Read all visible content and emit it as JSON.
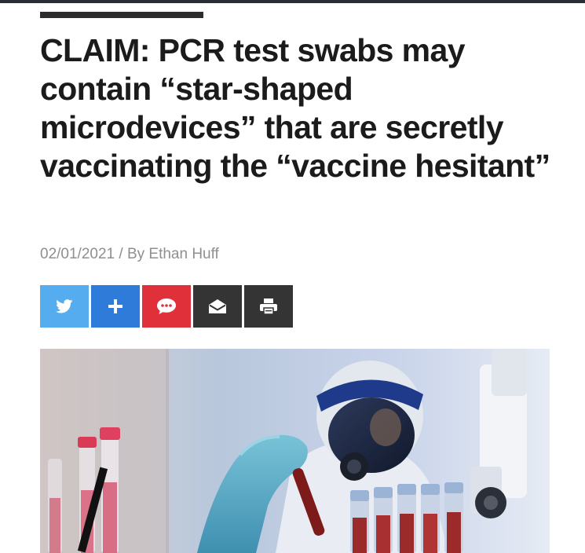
{
  "article": {
    "headline": "CLAIM: PCR test swabs may contain “star-shaped microdevices” that are secretly vaccinating the “vaccine hesitant”",
    "date": "02/01/2021",
    "separator": "/",
    "by_prefix": "By",
    "author": "Ethan Huff"
  },
  "share": [
    {
      "name": "twitter",
      "icon": "twitter-bird-icon",
      "color": "#55acee"
    },
    {
      "name": "share-more",
      "icon": "plus-icon",
      "color": "#2f7bd9"
    },
    {
      "name": "comment",
      "icon": "speech-bubble-icon",
      "color": "#e0313b"
    },
    {
      "name": "email",
      "icon": "envelope-icon",
      "color": "#343434"
    },
    {
      "name": "print",
      "icon": "printer-icon",
      "color": "#343434"
    }
  ],
  "colors": {
    "headline": "#1b1b1b",
    "meta": "#8f8f8f"
  }
}
